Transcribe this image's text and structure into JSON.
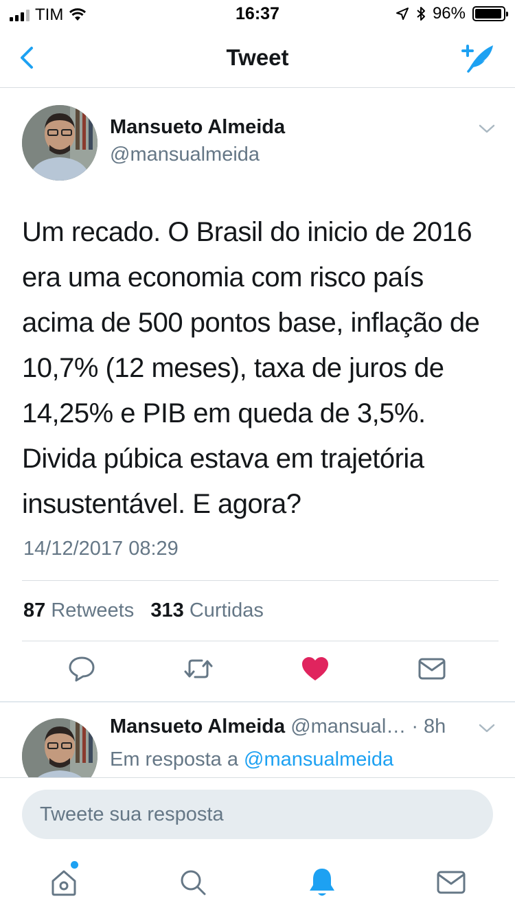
{
  "status_bar": {
    "carrier": "TIM",
    "time": "16:37",
    "battery": "96%",
    "battery_level": 0.96
  },
  "nav": {
    "title": "Tweet",
    "back_icon": "chevron-left-icon",
    "compose_icon": "compose-tweet-icon"
  },
  "tweet": {
    "author_name": "Mansueto Almeida",
    "author_handle": "@mansualmeida",
    "text": "Um recado. O Brasil do inicio de 2016 era uma economia com risco país acima de 500 pontos base, inflação de 10,7% (12 meses), taxa de juros de 14,25% e PIB em queda de 3,5%. Divida púbica estava em trajetória insustentável. E agora?",
    "timestamp": "14/12/2017 08:29",
    "retweets_count": "87",
    "retweets_label": "Retweets",
    "likes_count": "313",
    "likes_label": "Curtidas",
    "liked": true
  },
  "actions": [
    {
      "icon": "reply-icon"
    },
    {
      "icon": "retweet-icon"
    },
    {
      "icon": "heart-icon"
    },
    {
      "icon": "direct-message-icon"
    }
  ],
  "reply": {
    "author_name": "Mansueto Almeida",
    "author_handle": "@mansual…",
    "time": "· 8h",
    "in_reply_prefix": "Em resposta a",
    "in_reply_mention": "@mansualmeida"
  },
  "compose": {
    "placeholder": "Tweete sua resposta"
  },
  "tab_bar": [
    {
      "icon": "home-icon",
      "has_notification_dot": true
    },
    {
      "icon": "search-icon"
    },
    {
      "icon": "notifications-icon",
      "active": true
    },
    {
      "icon": "messages-icon"
    }
  ],
  "colors": {
    "accent": "#1da1f2",
    "like": "#e0245e",
    "secondary_text": "#657786",
    "divider": "#d8dde1"
  }
}
